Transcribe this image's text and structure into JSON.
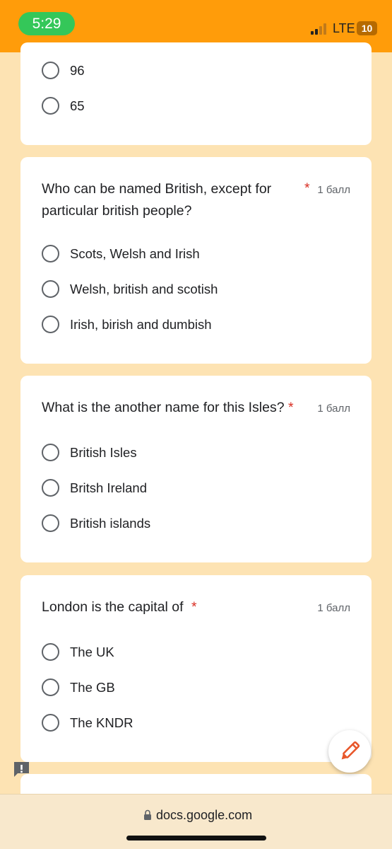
{
  "status_bar": {
    "time": "5:29",
    "network": "LTE",
    "battery": "10",
    "icons": [
      "cellular-signal-icon",
      "battery-icon"
    ]
  },
  "cards": [
    {
      "options": [
        "96",
        "65"
      ]
    },
    {
      "question": "Who can be named British, except for particular british people?",
      "required_mark": "*",
      "points": "1 балл",
      "options": [
        "Scots, Welsh and Irish",
        "Welsh, british and scotish",
        "Irish, birish and dumbish"
      ]
    },
    {
      "question": "What is the another name for this Isles?",
      "required_mark": "*",
      "points": "1 балл",
      "options": [
        "British Isles",
        "Britsh Ireland",
        "British islands"
      ]
    },
    {
      "question": "London is the capital of",
      "required_mark": "*",
      "points": "1 балл",
      "options": [
        "The UK",
        "The GB",
        "The KNDR"
      ]
    }
  ],
  "url_bar": {
    "url": "docs.google.com",
    "icons": [
      "lock-icon"
    ]
  },
  "floating": {
    "icons": [
      "edit-pencil-icon",
      "report-feedback-icon"
    ]
  },
  "colors": {
    "status_bar": "#ff9c0a",
    "page_background": "#fde3b3",
    "time_pill": "#34c759",
    "required": "#d93025",
    "edit_icon": "#e8572b"
  }
}
